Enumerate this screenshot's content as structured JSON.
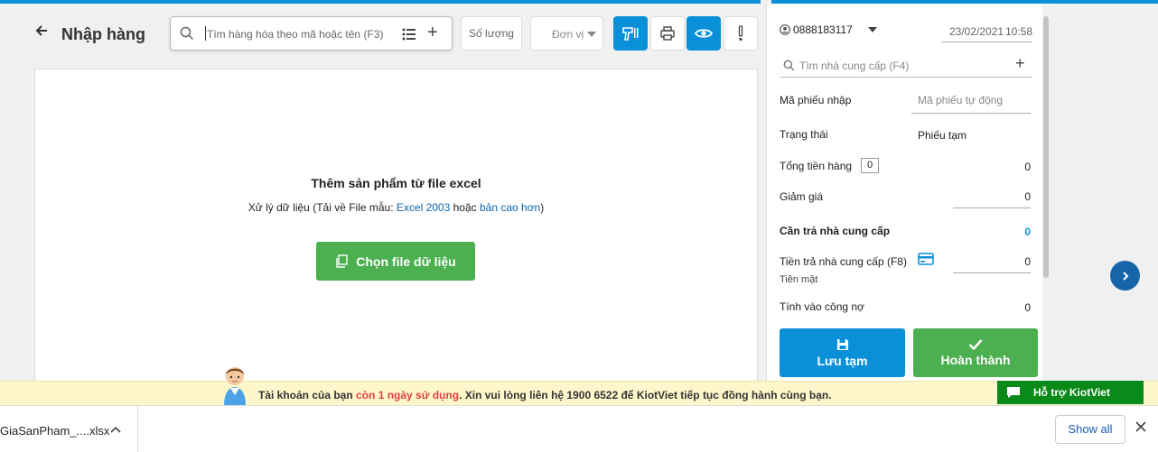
{
  "header": {
    "title": "Nhập hàng",
    "search_placeholder": "Tìm hàng hóa theo mã hoặc tên (F3)",
    "qty_label": "Số lượng",
    "unit_label": "Đơn vị"
  },
  "import_panel": {
    "title": "Thêm sản phẩm từ file excel",
    "sub_prefix": "Xử lý dữ liệu (Tải về File mẫu: ",
    "link_excel2003": "Excel 2003",
    "sub_or": " hoặc ",
    "link_newer": "bản cao hơn",
    "sub_suffix": ")",
    "choose_button": "Chọn file dữ liệu"
  },
  "sidebar": {
    "user": "0888183117",
    "date": "23/02/2021",
    "time": "10:58",
    "supplier_search_placeholder": "Tìm nhà cung cấp (F4)",
    "code_label": "Mã phiếu nhập",
    "code_placeholder": "Mã phiếu tự động",
    "status_label": "Trạng thái",
    "status_value": "Phiếu tạm",
    "total_label": "Tổng tiền hàng",
    "total_count": "0",
    "total_value": "0",
    "discount_label": "Giảm giá",
    "discount_value": "0",
    "payable_label": "Cần trả nhà cung cấp",
    "payable_value": "0",
    "paid_label": "Tiền trả nhà cung cấp (F8)",
    "paid_method": "Tiền mặt",
    "paid_value": "0",
    "debt_label": "Tính vào công nợ",
    "debt_value": "0",
    "save_button": "Lưu tạm",
    "done_button": "Hoàn thành"
  },
  "notice": {
    "prefix": "Tài khoản của bạn ",
    "highlight": "còn 1 ngày sử dụng",
    "suffix": ". Xin vui lòng liên hệ 1900 6522 để KiotViet tiếp tục đồng hành cùng bạn.",
    "support_label": "Hỗ trợ KiotViet"
  },
  "downloads": {
    "file_name": "GiaSanPham_....xlsx",
    "show_all": "Show all"
  },
  "colors": {
    "primary": "#0a90d8",
    "green": "#4caf50",
    "notice_bg": "#fff7cc",
    "support_green": "#0a8a18"
  }
}
